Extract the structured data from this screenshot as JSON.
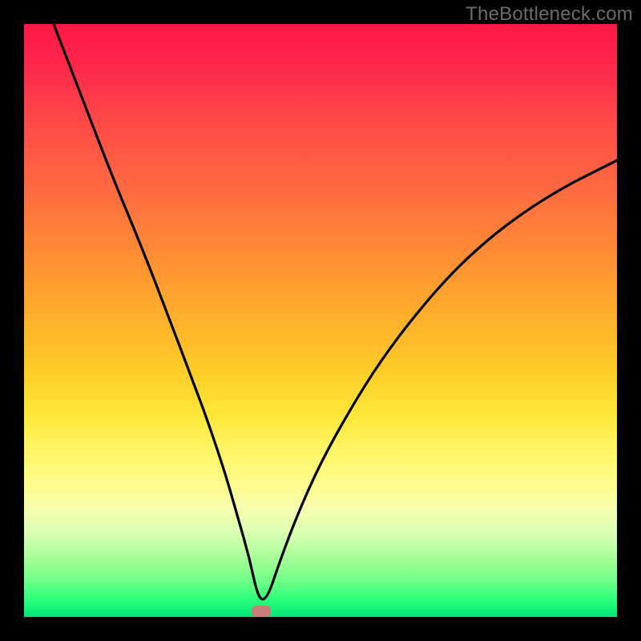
{
  "watermark": "TheBottleneck.com",
  "colors": {
    "top": "#ff1744",
    "mid1": "#ff8a36",
    "mid2": "#ffe73a",
    "bottom": "#00e676",
    "curve": "#000000",
    "marker": "#cd7c7c",
    "background": "#000000"
  },
  "chart_data": {
    "type": "line",
    "title": "",
    "xlabel": "",
    "ylabel": "",
    "xlim": [
      0,
      100
    ],
    "ylim": [
      0,
      100
    ],
    "annotations": [
      "TheBottleneck.com"
    ],
    "legend": {
      "visible": false
    },
    "grid": false,
    "min_marker": {
      "x": 40,
      "y": 1
    },
    "series": [
      {
        "name": "bottleneck-curve",
        "x": [
          5,
          10,
          15,
          20,
          25,
          28,
          31,
          34,
          36,
          38,
          39.5,
          41,
          43,
          46,
          50,
          55,
          60,
          66,
          73,
          81,
          90,
          100
        ],
        "y": [
          100,
          87,
          74,
          62,
          49,
          41,
          33,
          24,
          17,
          10,
          3,
          3,
          9,
          17,
          26,
          35,
          43,
          51,
          59,
          66,
          72,
          77
        ]
      }
    ]
  }
}
